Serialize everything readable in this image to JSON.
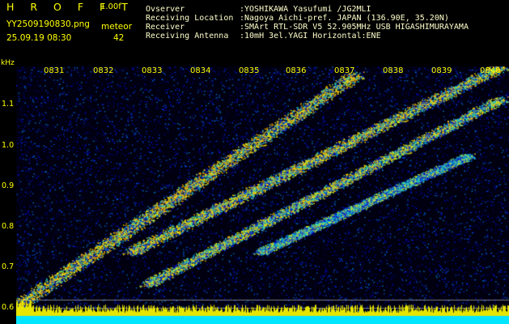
{
  "header": {
    "app_title": "H R O F F T",
    "app_version": "1.00f",
    "filename": "YY2509190830.png",
    "timestamp": "25.09.19 08:30",
    "meteor_label": "meteor",
    "meteor_count": "42"
  },
  "info": [
    {
      "key": "Ovserver",
      "value": ":YOSHIKAWA Yasufumi /JG2MLI"
    },
    {
      "key": "Receiving Location",
      "value": ":Nagoya Aichi-pref. JAPAN (136.90E, 35.20N)"
    },
    {
      "key": "Receiver",
      "value": ":SMArt RTL-SDR V5 52.905MHz USB HIGASHIMURAYAMA"
    },
    {
      "key": "Receiving Antenna",
      "value": ":10mH 3el.YAGI Horizontal:ENE"
    }
  ],
  "axis": {
    "y_unit": "kHz",
    "y_ticks": [
      "1.1",
      "1.0",
      "0.9",
      "0.8",
      "0.7",
      "0.6"
    ],
    "x_ticks": [
      "0831",
      "0832",
      "0833",
      "0834",
      "0835",
      "0836",
      "0837",
      "0838",
      "0839",
      "0840"
    ]
  },
  "colors": {
    "text": "#ffff00",
    "background": "#000000",
    "spectrum_low": "#00007a",
    "spectrum_high": "#ffff00",
    "baseline": "#00e5ff"
  }
}
